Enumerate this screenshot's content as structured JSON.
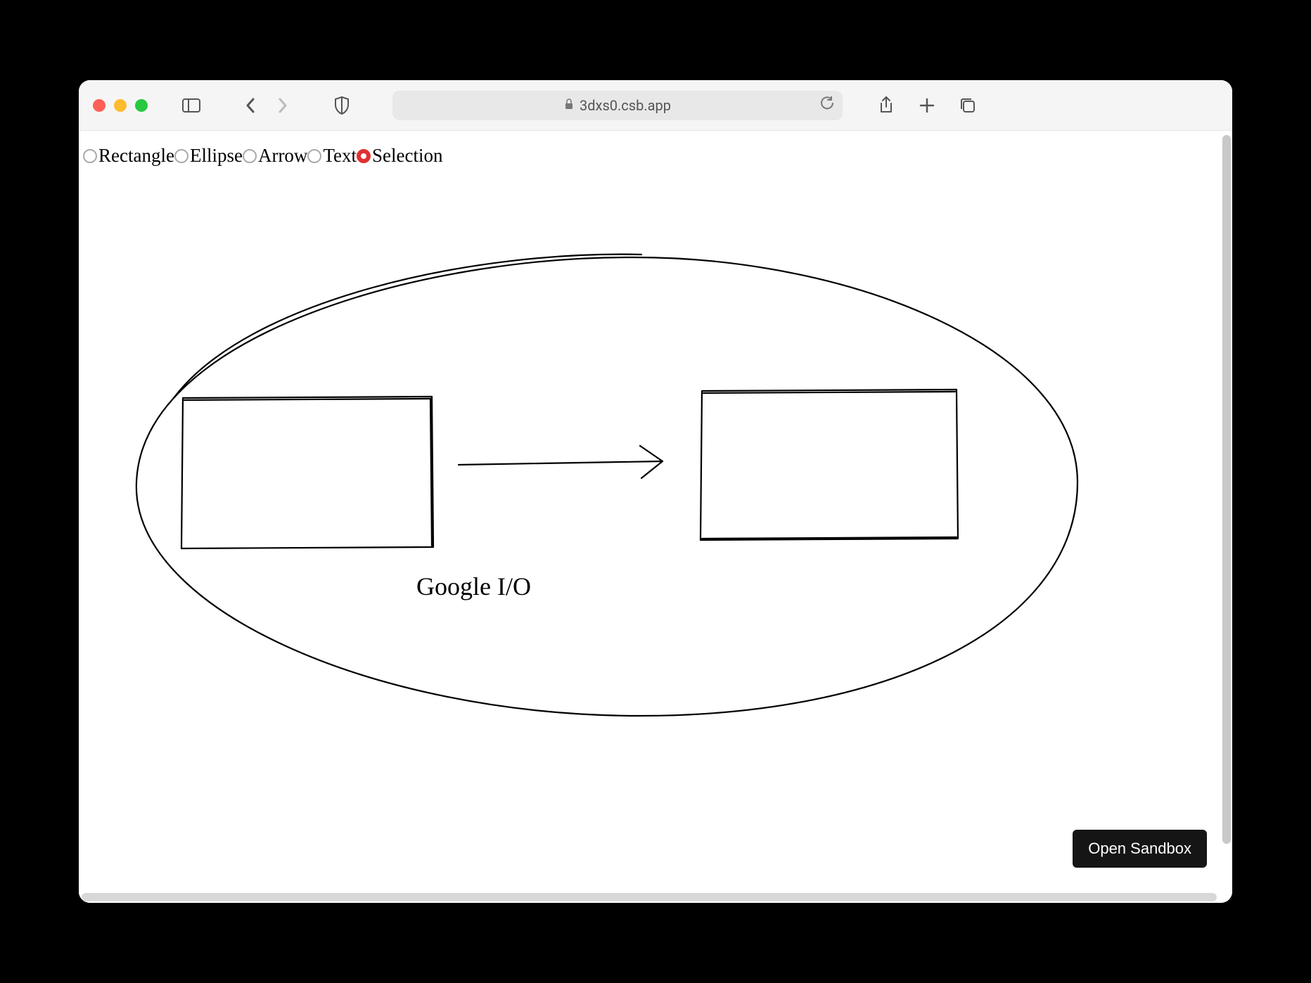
{
  "browser": {
    "url": "3dxs0.csb.app"
  },
  "toolbar": {
    "tools": [
      {
        "label": "Rectangle",
        "selected": false
      },
      {
        "label": "Ellipse",
        "selected": false
      },
      {
        "label": "Arrow",
        "selected": false
      },
      {
        "label": "Text",
        "selected": false
      },
      {
        "label": "Selection",
        "selected": true
      }
    ]
  },
  "canvas": {
    "text_label": "Google I/O"
  },
  "actions": {
    "open_sandbox": "Open Sandbox"
  }
}
